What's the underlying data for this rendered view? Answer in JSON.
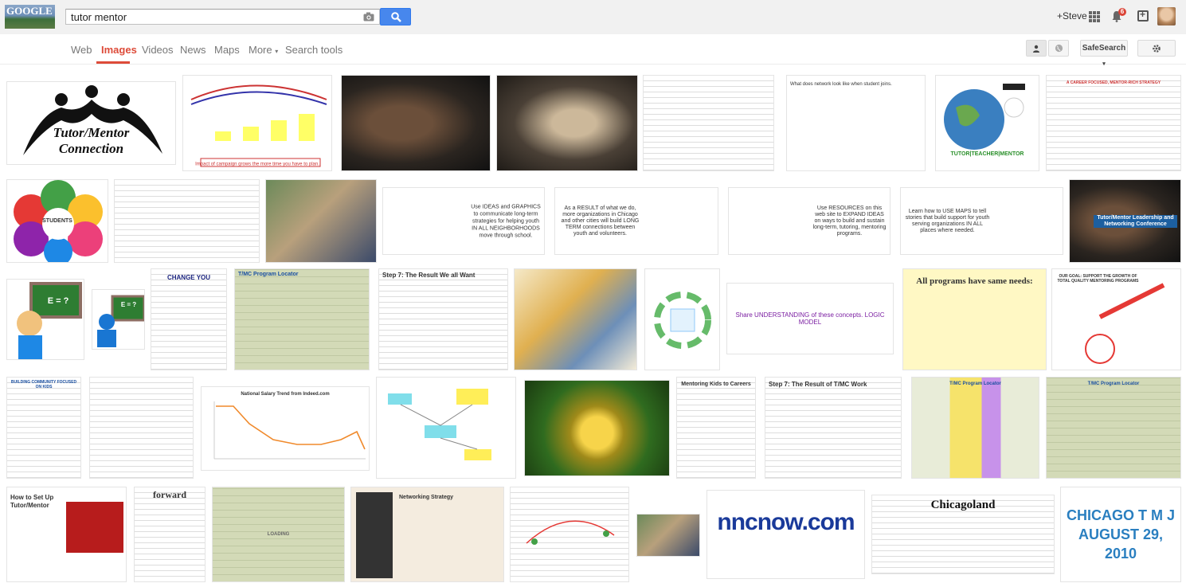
{
  "header": {
    "logo_text": "GOOGLE",
    "search_query": "tutor mentor",
    "camera_icon": "camera-icon",
    "search_icon": "magnifier-icon",
    "user_link": "+Steve",
    "notification_count": "6"
  },
  "nav": {
    "tabs": [
      {
        "label": "Web"
      },
      {
        "label": "Images"
      },
      {
        "label": "Videos"
      },
      {
        "label": "News"
      },
      {
        "label": "Maps"
      },
      {
        "label": "More"
      },
      {
        "label": "Search tools"
      }
    ],
    "more_caret": "▾",
    "safesearch_label": "SafeSearch",
    "safesearch_caret": "▾"
  },
  "results": {
    "thumbs": [
      {
        "caption": "Tutor/Mentor Connection"
      },
      {
        "caption": "Impact of campaign grows the more time you have to plan."
      },
      {
        "caption": ""
      },
      {
        "caption": ""
      },
      {
        "caption": ""
      },
      {
        "caption": "What does network look like when student joins."
      },
      {
        "caption": "TUTOR|TEACHER|MENTOR"
      },
      {
        "caption": "A CAREER FOCUSED, MENTOR-RICH STRATEGY"
      },
      {
        "caption": "STUDENTS"
      },
      {
        "caption": ""
      },
      {
        "caption": ""
      },
      {
        "caption": "Use IDEAS and GRAPHICS to communicate long-term strategies for helping youth IN ALL NEIGHBORHOODS move through school."
      },
      {
        "caption": "As a RESULT of what we do, more organizations in Chicago and other cities will build LONG TERM connections between youth and volunteers."
      },
      {
        "caption": "Use RESOURCES on this web site to EXPAND IDEAS on ways to build and sustain long-term, tutoring, mentoring programs."
      },
      {
        "caption": "Learn how to USE MAPS to tell stories that build support for youth serving organizations IN ALL places where needed."
      },
      {
        "caption": "Tutor/Mentor Leadership and Networking Conference"
      },
      {
        "caption": "E = ?"
      },
      {
        "caption": "E = ?"
      },
      {
        "caption": "CHANGE YOU"
      },
      {
        "caption": "T/MC Program Locator"
      },
      {
        "caption": "Step 7: The Result We all Want"
      },
      {
        "caption": ""
      },
      {
        "caption": ""
      },
      {
        "caption": "Share UNDERSTANDING of these concepts. LOGIC MODEL"
      },
      {
        "caption": "All programs have same needs:"
      },
      {
        "caption": "OUR GOAL: SUPPORT THE GROWTH OF TOTAL QUALITY MENTORING PROGRAMS"
      },
      {
        "caption": "BUILDING COMMUNITY FOCUSED ON KIDS"
      },
      {
        "caption": ""
      },
      {
        "caption": "National Salary Trend from Indeed.com"
      },
      {
        "caption": ""
      },
      {
        "caption": ""
      },
      {
        "caption": "Mentoring Kids to Careers"
      },
      {
        "caption": "Step 7: The Result of T/MC Work"
      },
      {
        "caption": "T/MC Program Locator"
      },
      {
        "caption": "T/MC Program Locator"
      },
      {
        "caption": "How to Set Up Tutor/Mentor"
      },
      {
        "caption": "forward"
      },
      {
        "caption": "LOADING"
      },
      {
        "caption": "Networking Strategy"
      },
      {
        "caption": ""
      },
      {
        "caption": ""
      },
      {
        "caption": "nncnow.com"
      },
      {
        "caption": "Chicagoland"
      },
      {
        "caption": "CHICAGO T M J AUGUST 29, 2010"
      }
    ]
  },
  "colors": {
    "accent_red": "#dd4b39",
    "search_blue": "#4787ed",
    "topbar_bg": "#f1f1f1"
  }
}
